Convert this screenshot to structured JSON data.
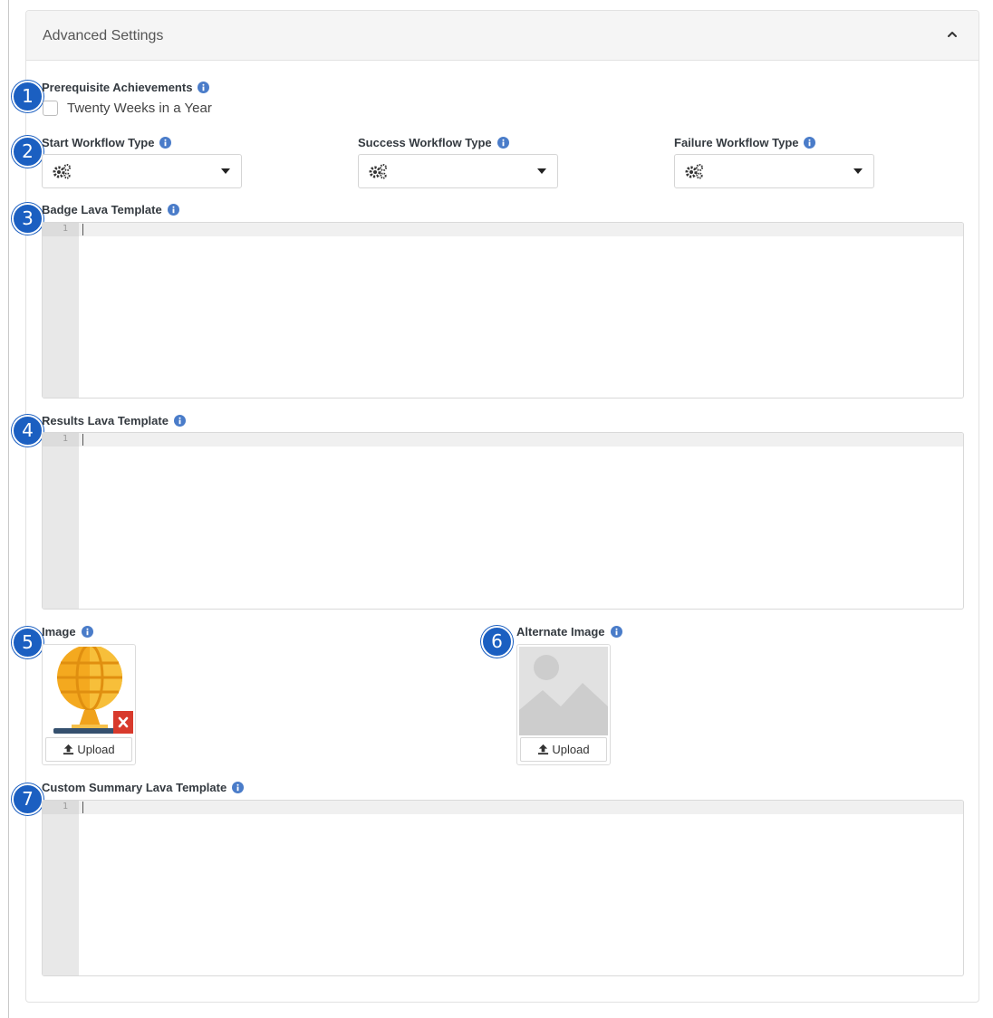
{
  "panel": {
    "title": "Advanced Settings"
  },
  "callouts": [
    "1",
    "2",
    "3",
    "4",
    "5",
    "6",
    "7"
  ],
  "prerequisite": {
    "label": "Prerequisite Achievements",
    "options": [
      {
        "label": "Twenty Weeks in a Year",
        "checked": false
      }
    ]
  },
  "workflows": {
    "start": {
      "label": "Start Workflow Type"
    },
    "success": {
      "label": "Success Workflow Type"
    },
    "failure": {
      "label": "Failure Workflow Type"
    }
  },
  "badge_template": {
    "label": "Badge Lava Template",
    "line_number": "1"
  },
  "results_template": {
    "label": "Results Lava Template",
    "line_number": "1"
  },
  "image": {
    "label": "Image",
    "upload_label": "Upload"
  },
  "alternate_image": {
    "label": "Alternate Image",
    "upload_label": "Upload"
  },
  "summary_template": {
    "label": "Custom Summary Lava Template",
    "line_number": "1"
  },
  "colors": {
    "callout": "#1b5fc1",
    "info_icon": "#4a7cc9",
    "remove": "#d83a2c"
  },
  "icons": {
    "info": "info-circle-icon",
    "gears": "cogs-icon",
    "collapse": "chevron-up-icon",
    "upload": "upload-icon",
    "remove": "times-icon",
    "placeholder": "image-placeholder-icon"
  }
}
